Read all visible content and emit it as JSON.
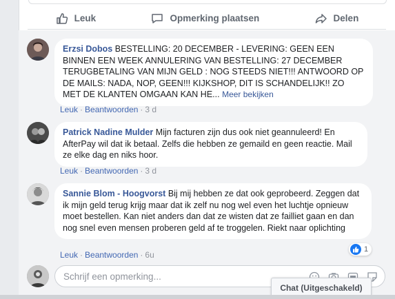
{
  "actions": {
    "like_label": "Leuk",
    "comment_label": "Opmerking plaatsen",
    "share_label": "Delen"
  },
  "comments": [
    {
      "author": "Erzsi Dobos",
      "text": "BESTELLING: 20 DECEMBER - LEVERING: GEEN EEN BINNEN EEN WEEK ANNULERING VAN BESTELLING: 27 DECEMBER TERUGBETALING VAN MIJN GELD : NOG STEEDS NIET!!! ANTWOORD OP DE MAILS: NADA, NOP, GEEN!!! KIJKSHOP, DIT IS SCHANDELIJK!! ZO MET DE KLANTEN OMGAAN KAN HE...",
      "see_more": "Meer bekijken",
      "like": "Leuk",
      "reply": "Beantwoorden",
      "time": "3 d"
    },
    {
      "author": "Patrick Nadine Mulder",
      "text": "Mijn facturen zijn dus ook niet geannuleerd! En AfterPay wil dat ik betaal. Zelfs die hebben ze gemaild en geen reactie. Mail ze elke dag en niks hoor.",
      "like": "Leuk",
      "reply": "Beantwoorden",
      "time": "3 d"
    },
    {
      "author": "Sannie Blom - Hoogvorst",
      "text": "Bij mij hebben ze dat ook geprobeerd. Zeggen dat ik mijn geld terug krijg maar dat ik zelf nu nog wel even het luchtje opnieuw moet bestellen. Kan niet anders dan dat ze wisten dat ze failliet gaan en dan nog snel even mensen proberen geld af te troggelen. Riekt naar oplichting",
      "like": "Leuk",
      "reply": "Beantwoorden",
      "time": "6u",
      "reaction_count": "1"
    }
  ],
  "composer": {
    "placeholder": "Schrijf een opmerking..."
  },
  "chat": {
    "label": "Chat (Uitgeschakeld)"
  },
  "colors": {
    "link": "#385898",
    "like_blue": "#1877f2",
    "background": "#f2f3f5"
  }
}
